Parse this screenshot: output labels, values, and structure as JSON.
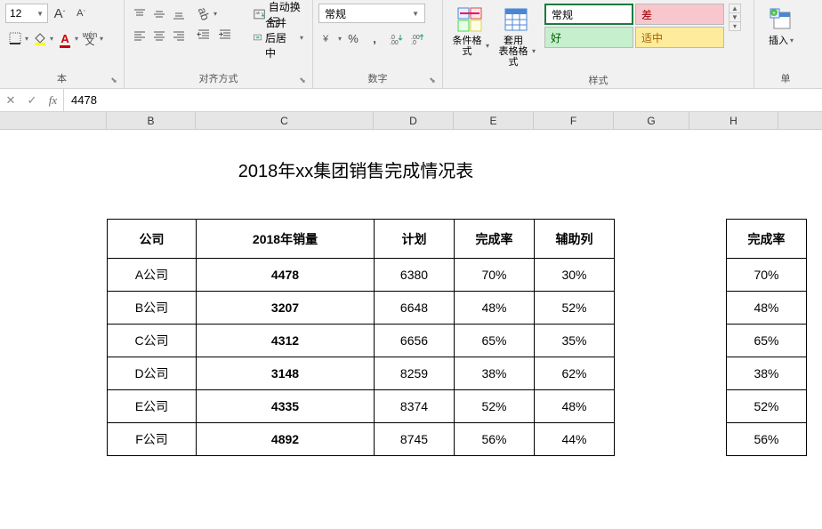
{
  "ribbon": {
    "font": {
      "size": "12",
      "incA": "A",
      "decA": "A",
      "ruby": "wén",
      "group_label": "本"
    },
    "align": {
      "wrap": "自动换行",
      "merge": "合并后居中",
      "group_label": "对齐方式"
    },
    "number": {
      "format": "常规",
      "group_label": "数字"
    },
    "styles": {
      "cond_fmt": "条件格式",
      "table_fmt": "套用\n表格格式",
      "normal": "常规",
      "bad": "差",
      "good": "好",
      "neutral": "适中",
      "group_label": "样式"
    },
    "cells": {
      "insert": "插入",
      "group_label": "单"
    }
  },
  "formula_bar": {
    "fx": "fx",
    "value": "4478"
  },
  "columns": {
    "B": "B",
    "C": "C",
    "D": "D",
    "E": "E",
    "F": "F",
    "G": "G",
    "H": "H"
  },
  "sheet": {
    "title": "2018年xx集团销售完成情况表",
    "headers": {
      "company": "公司",
      "sales": "2018年销量",
      "plan": "计划",
      "completion": "完成率",
      "aux": "辅助列",
      "completion2": "完成率"
    },
    "rows": [
      {
        "company": "A公司",
        "sales": "4478",
        "plan": "6380",
        "completion": "70%",
        "aux": "30%"
      },
      {
        "company": "B公司",
        "sales": "3207",
        "plan": "6648",
        "completion": "48%",
        "aux": "52%"
      },
      {
        "company": "C公司",
        "sales": "4312",
        "plan": "6656",
        "completion": "65%",
        "aux": "35%"
      },
      {
        "company": "D公司",
        "sales": "3148",
        "plan": "8259",
        "completion": "38%",
        "aux": "62%"
      },
      {
        "company": "E公司",
        "sales": "4335",
        "plan": "8374",
        "completion": "52%",
        "aux": "48%"
      },
      {
        "company": "F公司",
        "sales": "4892",
        "plan": "8745",
        "completion": "56%",
        "aux": "44%"
      }
    ]
  }
}
